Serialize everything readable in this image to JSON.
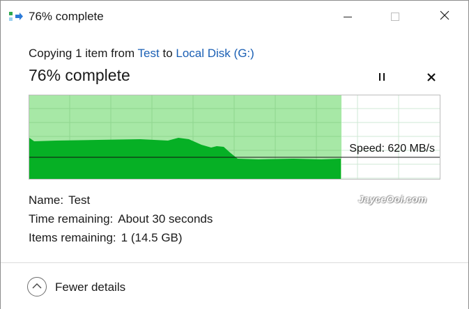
{
  "window": {
    "title": "76% complete",
    "minimize_icon": "minimize-icon",
    "maximize_icon": "maximize-icon",
    "close_icon": "close-icon"
  },
  "header": {
    "copying_prefix": "Copying 1 item from",
    "source": "Test",
    "to_word": "to",
    "destination": "Local Disk (G:)",
    "status": "76% complete",
    "pause_icon": "pause-icon",
    "cancel_icon": "close-icon"
  },
  "progress": {
    "fraction": 0.76,
    "speed_label": "Speed: 620 MB/s",
    "fill_color": "#06b025",
    "light_color": "#a7e8a6",
    "line_color": "#111111"
  },
  "details": {
    "name_label": "Name:",
    "name_value": "Test",
    "time_label": "Time remaining:",
    "time_value": "About 30 seconds",
    "items_label": "Items remaining:",
    "items_value": "1 (14.5 GB)"
  },
  "watermark": "JayceOoi.com",
  "footer": {
    "toggle_label": "Fewer details",
    "toggle_icon": "chevron-up-icon"
  }
}
